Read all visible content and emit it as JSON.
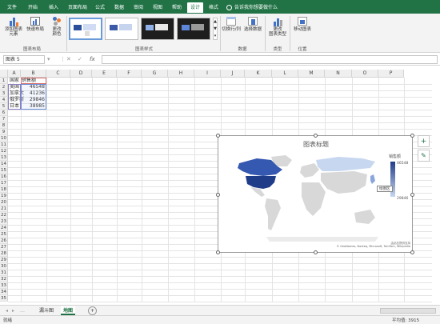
{
  "ribbon": {
    "tabs": [
      "文件",
      "开始",
      "插入",
      "页面布局",
      "公式",
      "数据",
      "审阅",
      "视图",
      "帮助",
      "设计",
      "格式"
    ],
    "active_tab": "设计",
    "tell_me": "告诉我你想要做什么",
    "buttons": {
      "add_element": "添加图表\n元素",
      "quick_layout": "快速布局",
      "change_colors": "更改\n颜色",
      "switch_row_col": "切换行/列",
      "select_data": "选择数据",
      "change_type": "更改\n图表类型",
      "move_chart": "移动图表"
    },
    "groups": {
      "layout": "图表布局",
      "styles": "图表样式",
      "data": "数据",
      "type": "类型",
      "location": "位置"
    }
  },
  "formula_bar": {
    "name_box": "图表 5",
    "cancel_icon": "✕",
    "enter_icon": "✓",
    "fx": "fx",
    "value": ""
  },
  "grid": {
    "columns": [
      "A",
      "B",
      "C",
      "D",
      "E",
      "F",
      "G",
      "H",
      "I",
      "J",
      "K",
      "L",
      "M",
      "N",
      "O",
      "P"
    ],
    "rows": [
      "1",
      "2",
      "3",
      "4",
      "5",
      "6",
      "7",
      "8",
      "9",
      "10",
      "11",
      "12",
      "13",
      "14",
      "15",
      "16",
      "17",
      "18",
      "19",
      "20",
      "21",
      "22",
      "23",
      "24",
      "25",
      "26",
      "27",
      "28",
      "29",
      "30",
      "31",
      "32",
      "33",
      "34",
      "35"
    ],
    "table": {
      "headers": [
        "国家",
        "销售额"
      ],
      "rows": [
        {
          "country": "美国",
          "value": "46548"
        },
        {
          "country": "加拿大",
          "value": "41236"
        },
        {
          "country": "俄罗斯",
          "value": "29846"
        },
        {
          "country": "日本",
          "value": "38985"
        }
      ]
    }
  },
  "chart": {
    "title": "图表标题",
    "legend_title": "销售额",
    "legend_max": "46548",
    "legend_min": "29846",
    "tooltip": "绘图区",
    "credit": "由必应提供支持\n© GeoNames, Navteq, Microsoft, TomTom, Wikipedia"
  },
  "side_buttons": {
    "add": "+",
    "style": "✎"
  },
  "sheets": {
    "tabs": [
      "漏斗图",
      "地图"
    ],
    "active": "地图",
    "add": "+"
  },
  "status": {
    "left": "就绪",
    "right": "平均值: 3915"
  },
  "colors": {
    "excel_green": "#217346",
    "map_dark": "#2b4f9b",
    "map_light": "#cfdcf3",
    "map_gray": "#d8d8d8"
  }
}
